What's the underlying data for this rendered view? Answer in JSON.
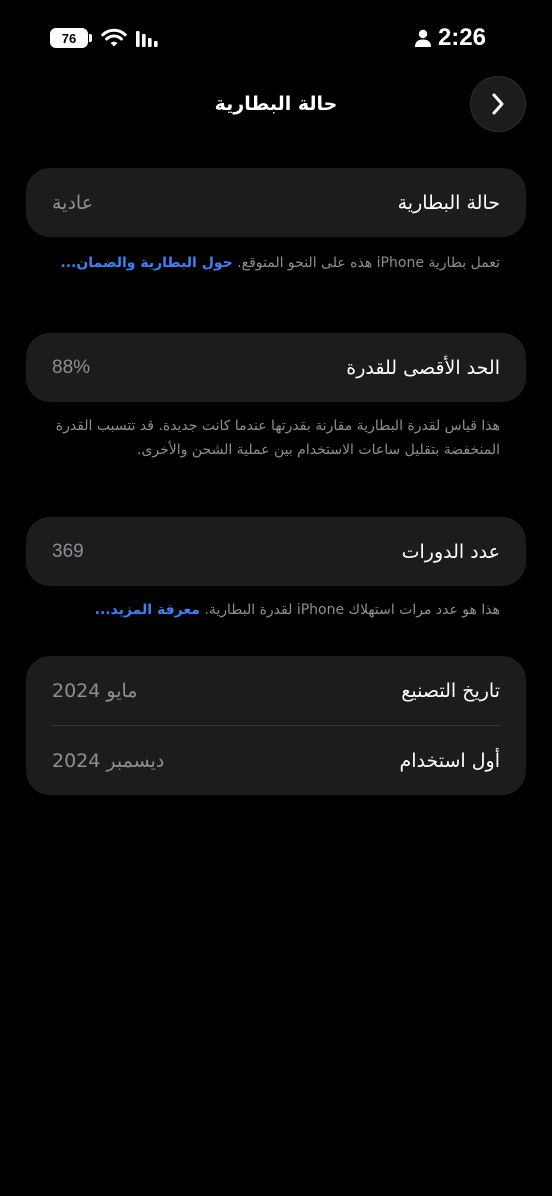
{
  "status_bar": {
    "battery_level": "76",
    "time": "2:26",
    "icons": [
      "wifi-icon",
      "cellular-signal-icon",
      "person-icon"
    ]
  },
  "nav": {
    "title": "حالة البطارية",
    "back_icon": "chevron-right-icon"
  },
  "battery_condition": {
    "label": "حالة البطارية",
    "value": "عادية",
    "footnote_text": "تعمل بطارية iPhone هذه على النحو المتوقع. ",
    "footnote_link": "حول البطارية والضمان..."
  },
  "maximum_capacity": {
    "label": "الحد الأقصى للقدرة",
    "value": "88%",
    "footnote_text": "هذا قياس لقدرة البطارية مقارنة بقدرتها عندما كانت جديدة. قد تتسبب القدرة المنخفضة بتقليل ساعات الاستخدام بين عملية الشحن والأخرى."
  },
  "cycle_count": {
    "label": "عدد الدورات",
    "value": "369",
    "footnote_text": "هذا هو عدد مرات استهلاك iPhone لقدرة البطارية. ",
    "footnote_link": "معرفة المزيد..."
  },
  "dates": {
    "manufacture_label": "تاريخ التصنيع",
    "manufacture_value": "مايو 2024",
    "first_use_label": "أول استخدام",
    "first_use_value": "ديسمبر 2024"
  },
  "colors": {
    "background": "#000000",
    "card": "#1c1c1e",
    "secondary_text": "#8e8e93",
    "link": "#3b82f6"
  }
}
